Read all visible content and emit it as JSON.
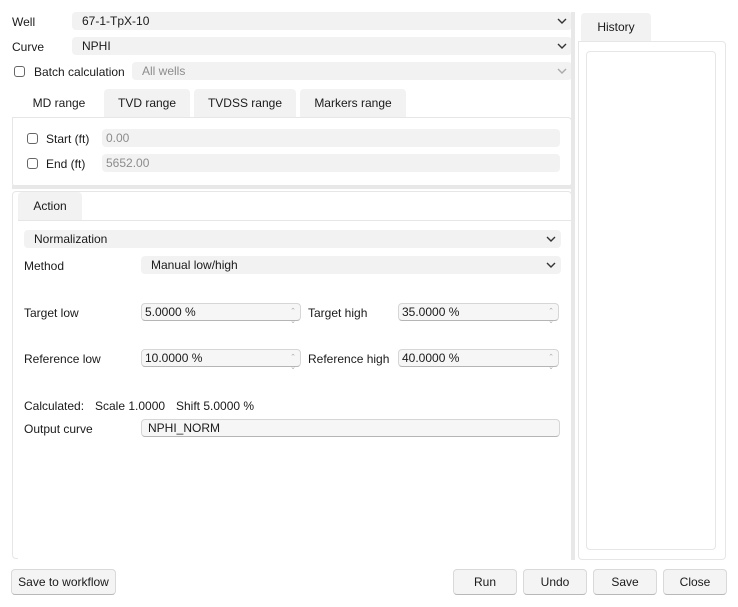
{
  "well": {
    "label": "Well",
    "value": "67-1-TpX-10"
  },
  "curve": {
    "label": "Curve",
    "value": "NPHI"
  },
  "batch": {
    "label": "Batch calculation",
    "value": "All wells"
  },
  "range_tabs": [
    "MD range",
    "TVD range",
    "TVDSS range",
    "Markers range"
  ],
  "range": {
    "start_label": "Start (ft)",
    "start_value": "0.00",
    "end_label": "End (ft)",
    "end_value": "5652.00"
  },
  "action_tab": "Action",
  "action": {
    "type": "Normalization",
    "method_label": "Method",
    "method_value": "Manual low/high",
    "target_low_label": "Target low",
    "target_low_value": "5.0000 %",
    "target_high_label": "Target high",
    "target_high_value": "35.0000 %",
    "reference_low_label": "Reference low",
    "reference_low_value": "10.0000 %",
    "reference_high_label": "Reference high",
    "reference_high_value": "40.0000 %",
    "calculated_label": "Calculated:",
    "scale_text": "Scale 1.0000",
    "shift_text": "Shift 5.0000 %",
    "output_label": "Output curve",
    "output_value": "NPHI_NORM"
  },
  "history_tab": "History",
  "buttons": {
    "save_workflow": "Save to workflow",
    "run": "Run",
    "undo": "Undo",
    "save": "Save",
    "close": "Close"
  }
}
